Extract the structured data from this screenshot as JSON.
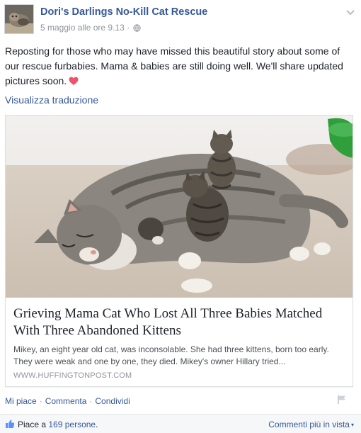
{
  "header": {
    "page_name": "Dori's Darlings No-Kill Cat Rescue",
    "timestamp": "5 maggio alle ore 9.13",
    "separator": "·",
    "privacy_icon": "globe-icon",
    "menu_icon": "chevron-down-icon"
  },
  "post": {
    "text": "Reposting for those who may have missed this beautiful story about some of our rescue furbabies. Mama & babies are still doing well. We'll share updated pictures soon.",
    "emoji": "heart-icon",
    "translate_label": "Visualizza traduzione"
  },
  "link_card": {
    "image_icon": "cat-photo",
    "title": "Grieving Mama Cat Who Lost All Three Babies Matched With Three Abandoned Kittens",
    "description": "Mikey, an eight year old cat, was inconsolable. She had three kittens, born too early. They were weak and one by one, they died. Mikey's owner Hillary tried...",
    "domain": "WWW.HUFFINGTONPOST.COM"
  },
  "actions": {
    "like": "Mi piace",
    "comment": "Commenta",
    "share": "Condividi",
    "separator": "·",
    "flag_icon": "flag-icon"
  },
  "likes": {
    "prefix": "Piace a",
    "count_label": "169 persone",
    "suffix": ".",
    "sort_label": "Commenti più in vista",
    "sort_caret": "▾"
  },
  "colors": {
    "link": "#365899",
    "meta": "#90949c",
    "heart": "#f25268",
    "likes_bar": "#f6f7f9"
  }
}
